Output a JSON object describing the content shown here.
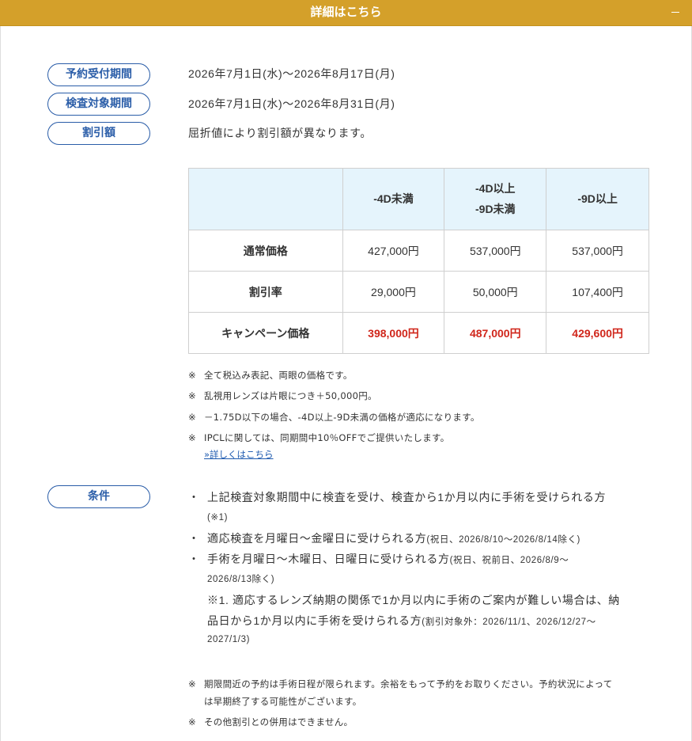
{
  "header": {
    "title": "詳細はこちら"
  },
  "info": [
    {
      "label": "予約受付期間",
      "value": "2026年7月1日(水)～2026年8月17日(月)"
    },
    {
      "label": "検査対象期間",
      "value": "2026年7月1日(水)～2026年8月31日(月)"
    },
    {
      "label": "割引額",
      "value": "屈折値により割引額が異なります。"
    }
  ],
  "table": {
    "headers": [
      "",
      "-4D未満",
      "-4D以上\n-9D未満",
      "-9D以上"
    ],
    "header_lines": [
      [
        "-4D未満"
      ],
      [
        "-4D以上",
        "-9D未満"
      ],
      [
        "-9D以上"
      ]
    ],
    "rows": [
      {
        "label": "通常価格",
        "cells": [
          "427,000円",
          "537,000円",
          "537,000円"
        ]
      },
      {
        "label": "割引率",
        "cells": [
          "29,000円",
          "50,000円",
          "107,400円"
        ]
      },
      {
        "label": "キャンペーン価格",
        "cells": [
          "398,000円",
          "487,000円",
          "429,600円"
        ]
      }
    ]
  },
  "notes": [
    {
      "mark": "※",
      "text": "全て税込み表記、両眼の価格です。"
    },
    {
      "mark": "※",
      "text": "乱視用レンズは片眼につき＋50,000円。"
    },
    {
      "mark": "※",
      "text": "－1.75D以下の場合、-4D以上-9D未満の価格が適応になります。"
    },
    {
      "mark": "※",
      "text": "IPCLに関しては、同期間中10％OFFでご提供いたします。"
    }
  ],
  "notes_link": "»詳しくはこちら",
  "conditions": {
    "label": "条件",
    "bullet": "・",
    "item1": "上記検査対象期間中に検査を受け、検査から1か月以内に手術を受けられる方",
    "item1_note": "(※1)",
    "item2": "適応検査を月曜日～金曜日に受けられる方",
    "item2_note": "(祝日、2026/8/10～2026/8/14除く)",
    "item3": "手術を月曜日～木曜日、日曜日に受けられる方",
    "item3_note_a": "(祝日、祝前日、2026/8/9～",
    "item3_note_b": "2026/8/13除く)",
    "footnote_line1": "※1. 適応するレンズ納期の関係で1か月以内に手術のご案内が難しい場合は、納",
    "footnote_line2": "品日から1か月以内に手術を受けられる方",
    "footnote_note_a": "(割引対象外：2026/11/1、2026/12/27～",
    "footnote_note_b": "2027/1/3)"
  },
  "bottom_notes": {
    "mark": "※",
    "line1": "期限間近の予約は手術日程が限られます。余裕をもって予約をお取りください。予約状況によって",
    "line1_cont": "は早期終了する可能性がございます。",
    "line2": "その他割引との併用はできません。"
  },
  "colors": {
    "header_bg": "#d4a02a",
    "pill_border": "#2a5da8",
    "table_header_bg": "#e5f4fc",
    "campaign_price": "#d0261b"
  }
}
